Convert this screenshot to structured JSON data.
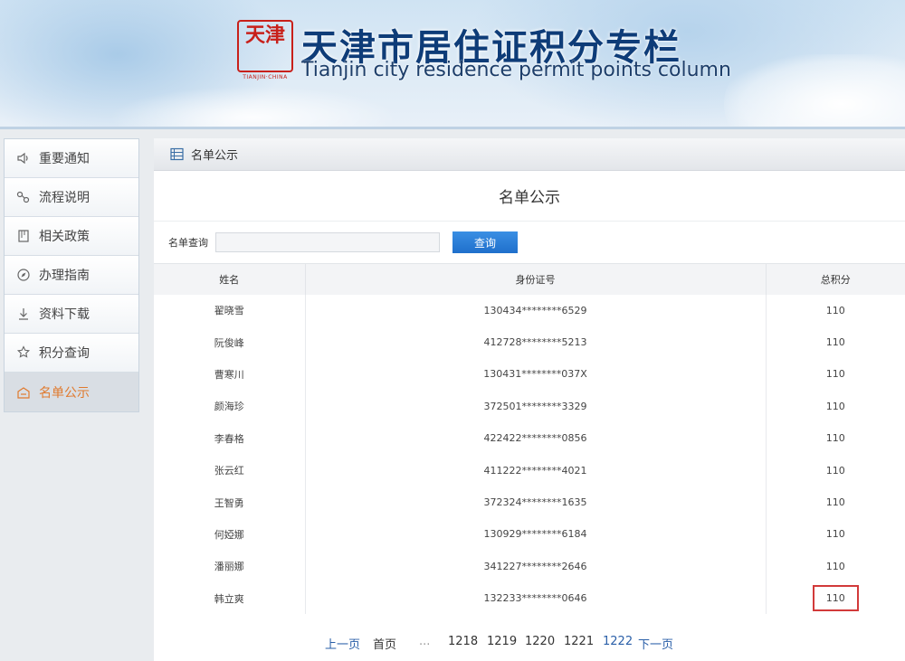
{
  "header": {
    "logo_text": "天津",
    "logo_subtext": "TIANJIN·CHINA",
    "title_cn": "天津市居住证积分专栏",
    "title_en": "Tianjin city residence permit points column"
  },
  "sidebar": {
    "items": [
      {
        "label": "重要通知",
        "icon": "speaker-icon"
      },
      {
        "label": "流程说明",
        "icon": "flow-icon"
      },
      {
        "label": "相关政策",
        "icon": "document-icon"
      },
      {
        "label": "办理指南",
        "icon": "compass-icon"
      },
      {
        "label": "资料下载",
        "icon": "download-icon"
      },
      {
        "label": "积分查询",
        "icon": "search-star-icon"
      },
      {
        "label": "名单公示",
        "icon": "home-list-icon",
        "active": true
      }
    ]
  },
  "breadcrumb": {
    "label": "名单公示",
    "icon": "list-icon"
  },
  "main": {
    "title": "名单公示",
    "search_label": "名单查询",
    "search_value": "",
    "search_button": "查询"
  },
  "table": {
    "columns": [
      "姓名",
      "身份证号",
      "总积分"
    ],
    "rows": [
      {
        "name": "翟晓雪",
        "id": "130434********6529",
        "score": "110"
      },
      {
        "name": "阮俊峰",
        "id": "412728********5213",
        "score": "110"
      },
      {
        "name": "曹寒川",
        "id": "130431********037X",
        "score": "110"
      },
      {
        "name": "颜海珍",
        "id": "372501********3329",
        "score": "110"
      },
      {
        "name": "李春格",
        "id": "422422********0856",
        "score": "110"
      },
      {
        "name": "张云红",
        "id": "411222********4021",
        "score": "110"
      },
      {
        "name": "王智勇",
        "id": "372324********1635",
        "score": "110"
      },
      {
        "name": "何婭娜",
        "id": "130929********6184",
        "score": "110"
      },
      {
        "name": "潘丽娜",
        "id": "341227********2646",
        "score": "110"
      },
      {
        "name": "韩立爽",
        "id": "132233********0646",
        "score": "110"
      }
    ]
  },
  "pager": {
    "prev": "上一页",
    "first": "首页",
    "ellipsis": "...",
    "pages": [
      "1218",
      "1219",
      "1220",
      "1221"
    ],
    "current": "1222",
    "next": "下一页"
  },
  "colors": {
    "accent": "#1f6fcc",
    "active_sidebar_text": "#e07a2e",
    "highlight_border": "#d23a3a",
    "title_blue": "#0e3c78"
  }
}
